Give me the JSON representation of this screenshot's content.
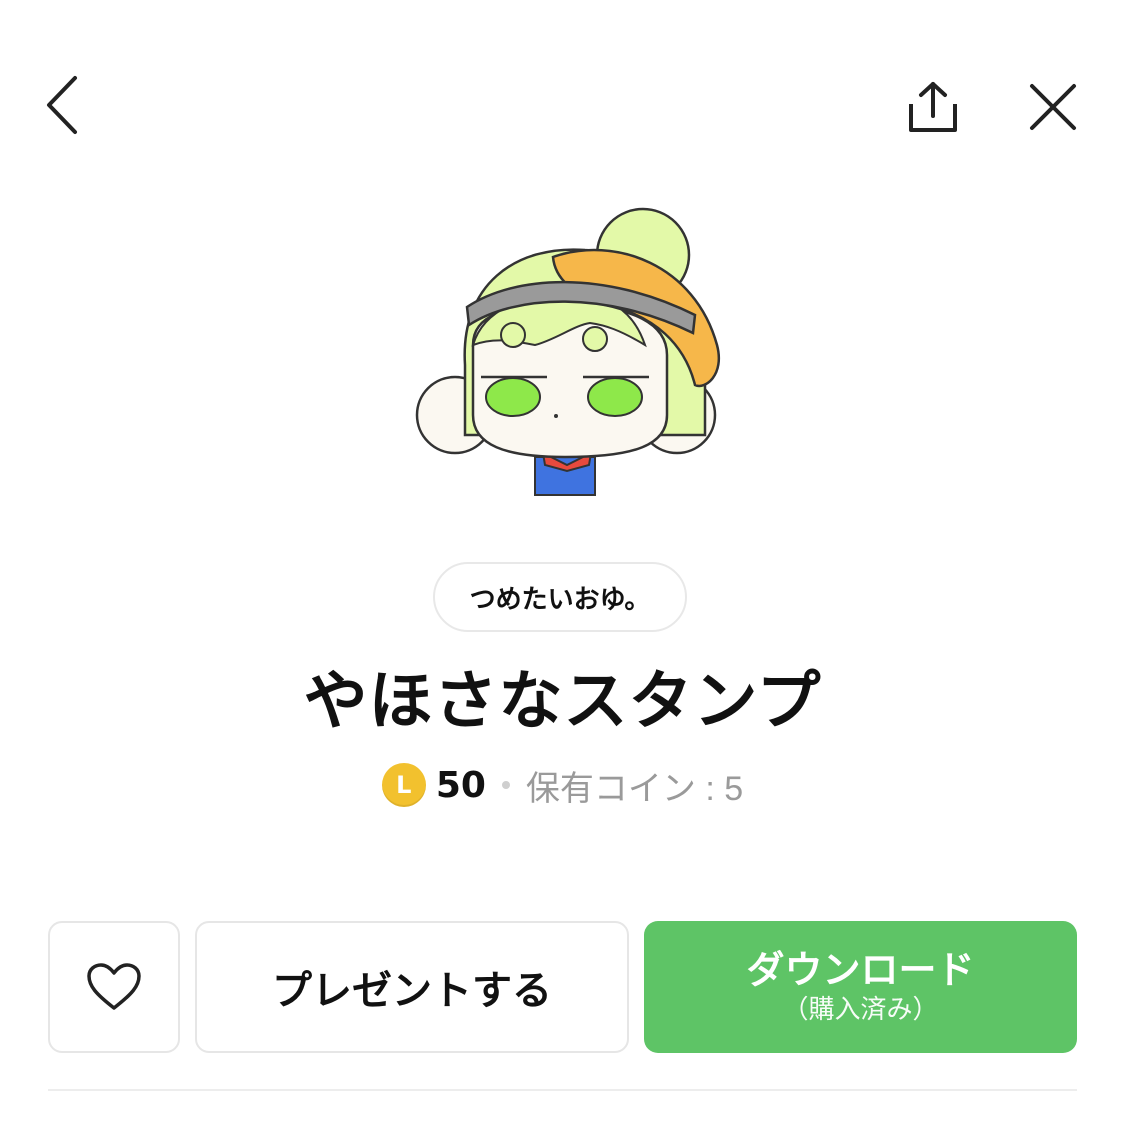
{
  "nav": {
    "back_icon": "chevron-left-icon",
    "share_icon": "share-icon",
    "close_icon": "close-icon"
  },
  "sticker": {
    "image": "sticker-character-illustration"
  },
  "product": {
    "author": "つめたいおゆ。",
    "title": "やほさなスタンプ",
    "coin_letter": "L",
    "price": "50",
    "owned_coins": "保有コイン : 5"
  },
  "actions": {
    "like_icon": "heart-icon",
    "present_label": "プレゼントする",
    "download_label": "ダウンロード",
    "download_sub": "（購入済み）"
  },
  "colors": {
    "accent_green": "#5ec466",
    "coin_gold": "#f2c12e",
    "muted_text": "#9a9a9a"
  }
}
